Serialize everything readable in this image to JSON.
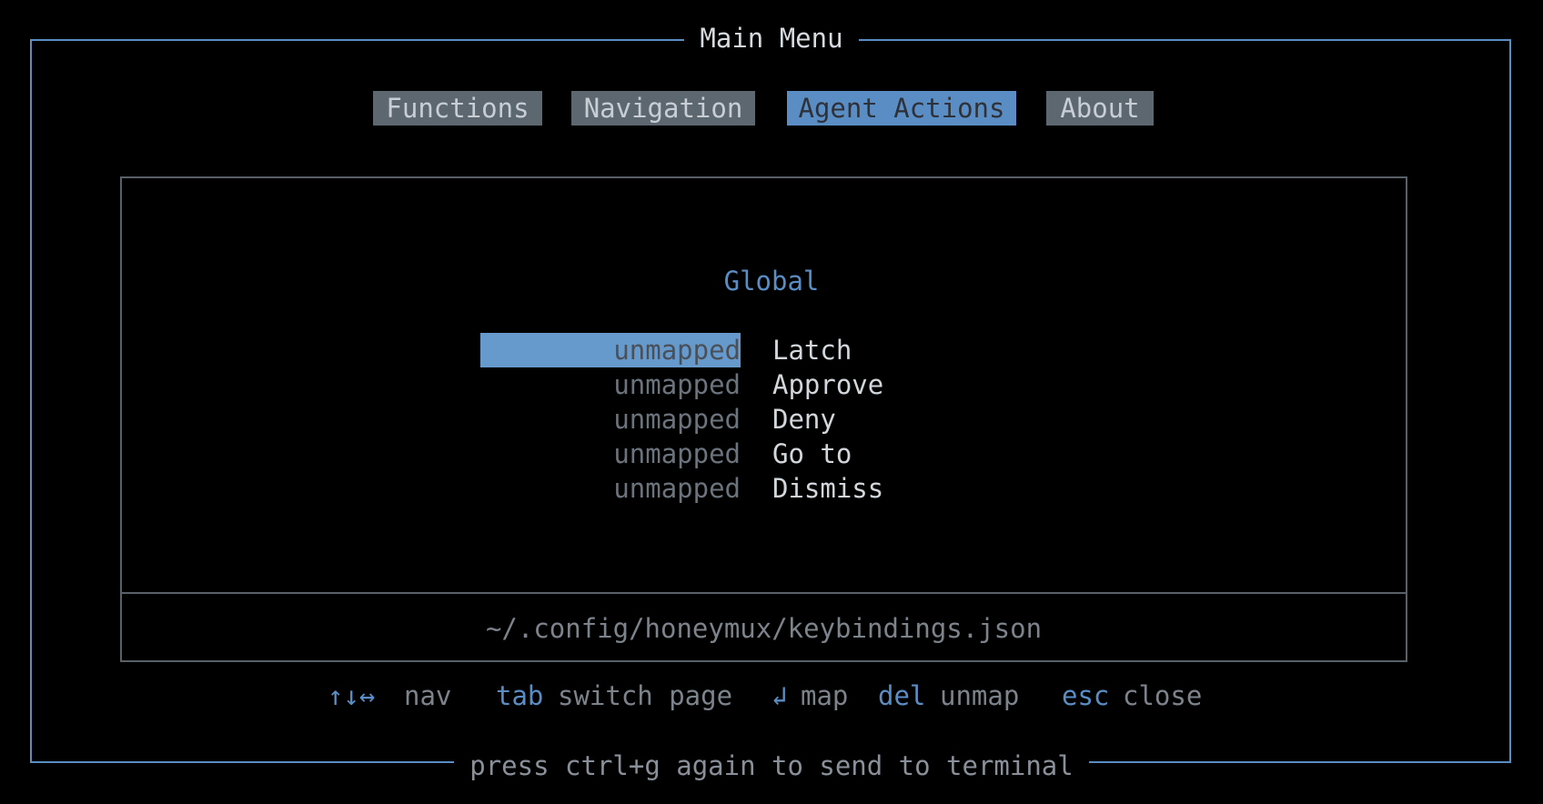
{
  "window": {
    "title": "Main Menu",
    "footer": "press ctrl+g again to send to terminal"
  },
  "tabs": [
    {
      "label": "Functions",
      "active": false
    },
    {
      "label": "Navigation",
      "active": false
    },
    {
      "label": "Agent Actions",
      "active": true
    },
    {
      "label": "About",
      "active": false
    }
  ],
  "section": {
    "title": "Global"
  },
  "bindings": [
    {
      "key": "unmapped",
      "action": "Latch",
      "selected": true
    },
    {
      "key": "unmapped",
      "action": "Approve",
      "selected": false
    },
    {
      "key": "unmapped",
      "action": "Deny",
      "selected": false
    },
    {
      "key": "unmapped",
      "action": "Go to",
      "selected": false
    },
    {
      "key": "unmapped",
      "action": "Dismiss",
      "selected": false
    }
  ],
  "config_path": "~/.config/honeymux/keybindings.json",
  "help": [
    {
      "key": "↑↓↔",
      "desc": "nav"
    },
    {
      "key": "tab",
      "desc": "switch page"
    },
    {
      "key": "↲",
      "desc": "map"
    },
    {
      "key": "del",
      "desc": "unmap"
    },
    {
      "key": "esc",
      "desc": "close"
    }
  ],
  "colors": {
    "accent": "#5b8dc5",
    "selection": "#6699cc",
    "tab_inactive": "#5d6770",
    "background": "#000000",
    "muted_text": "#7d838b"
  }
}
